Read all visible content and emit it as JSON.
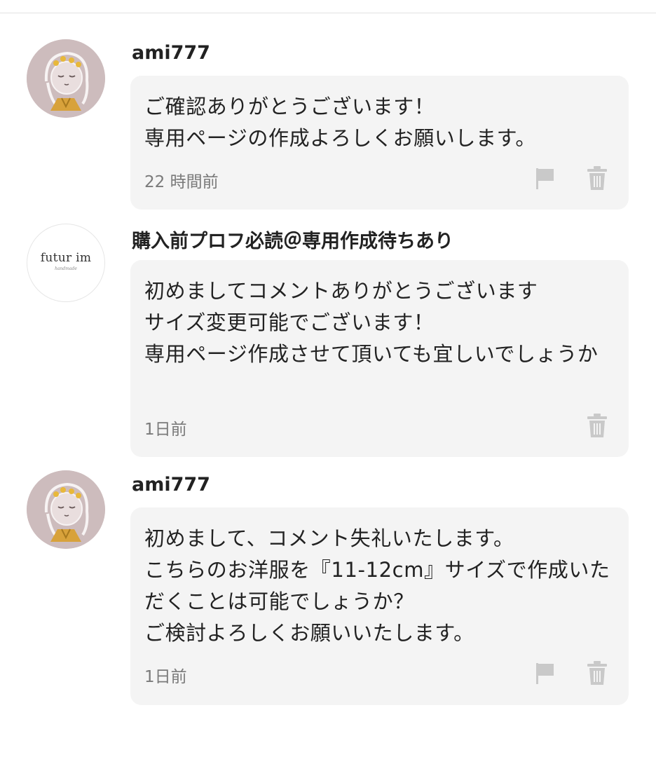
{
  "comments": [
    {
      "username": "ami777",
      "avatar": "girl-illustration",
      "message": "ご確認ありがとうございます！\n専用ページの作成よろしくお願いします。",
      "time": "22 時間前",
      "actions": [
        "flag-icon",
        "trash-icon"
      ]
    },
    {
      "username": "購入前プロフ必読＠専用作成待ちあり",
      "avatar": "shop-logo",
      "avatar_logo_text": "futur im",
      "avatar_logo_subtext": "handmade",
      "message": "初めましてコメントありがとうございます\nサイズ変更可能でございます！\n専用ページ作成させて頂いても宜しいでしょうか",
      "time": "1日前",
      "actions": [
        "trash-icon"
      ]
    },
    {
      "username": "ami777",
      "avatar": "girl-illustration",
      "message": "初めまして、コメント失礼いたします。\nこちらのお洋服を『11-12cm』サイズで作成いただくことは可能でしょうか？\nご検討よろしくお願いいたします。",
      "time": "1日前",
      "actions": [
        "flag-icon",
        "trash-icon"
      ]
    }
  ],
  "colors": {
    "bubble": "#f4f4f4",
    "icon": "#c9c9c9",
    "timestamp": "#7a7a7a"
  }
}
